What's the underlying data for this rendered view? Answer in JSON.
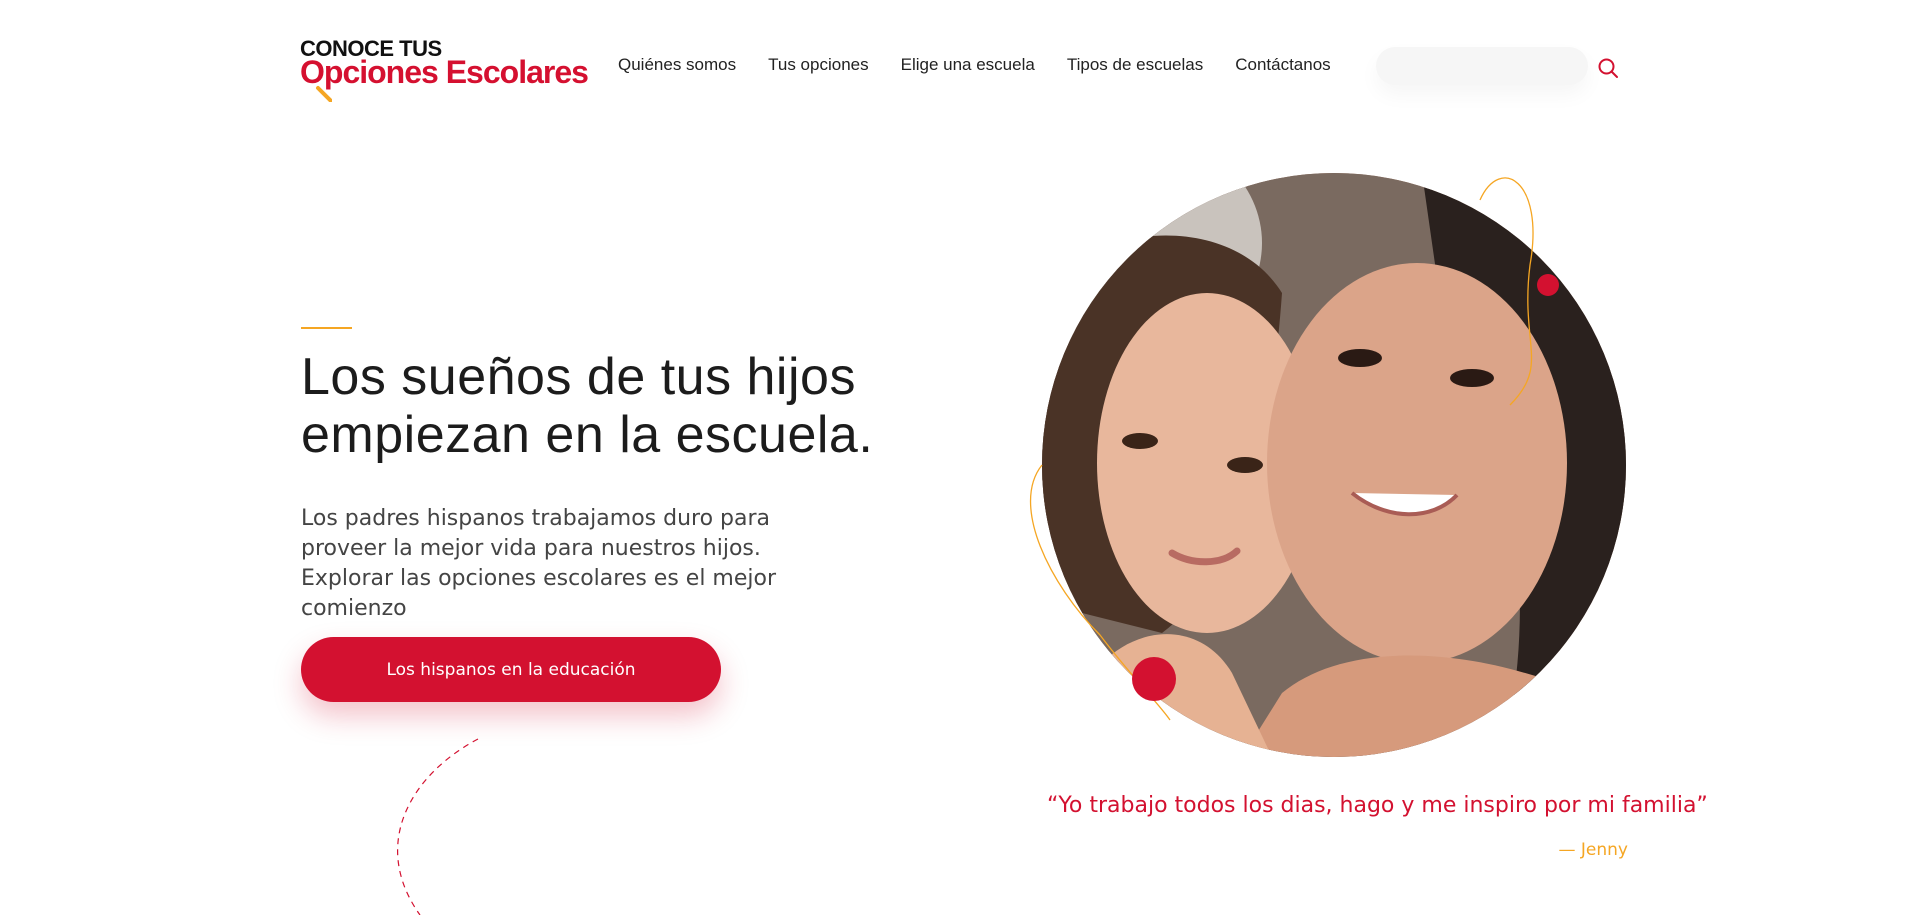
{
  "header": {
    "logo_top": "CONOCE TUS",
    "logo_bottom": "Opciones Escolares",
    "nav": [
      {
        "label": "Quiénes somos"
      },
      {
        "label": "Tus opciones"
      },
      {
        "label": "Elige una escuela"
      },
      {
        "label": "Tipos de escuelas"
      },
      {
        "label": "Contáctanos"
      }
    ],
    "search": {
      "placeholder": "",
      "icon": "search-icon"
    }
  },
  "hero": {
    "headline": "Los sueños de tus hijos empiezan en la escuela.",
    "lead": "Los padres hispanos trabajamos duro para proveer la mejor vida para nuestros hijos. Explorar las opciones escolares es el mejor comienzo",
    "cta_label": "Los hispanos en la educación"
  },
  "testimonial": {
    "quote": "“Yo trabajo todos los dias, hago y me inspiro por mi familia”",
    "author": "— Jenny"
  },
  "colors": {
    "brand_red": "#d31130",
    "accent_orange": "#f5a623",
    "text_dark": "#1c1c1c"
  }
}
